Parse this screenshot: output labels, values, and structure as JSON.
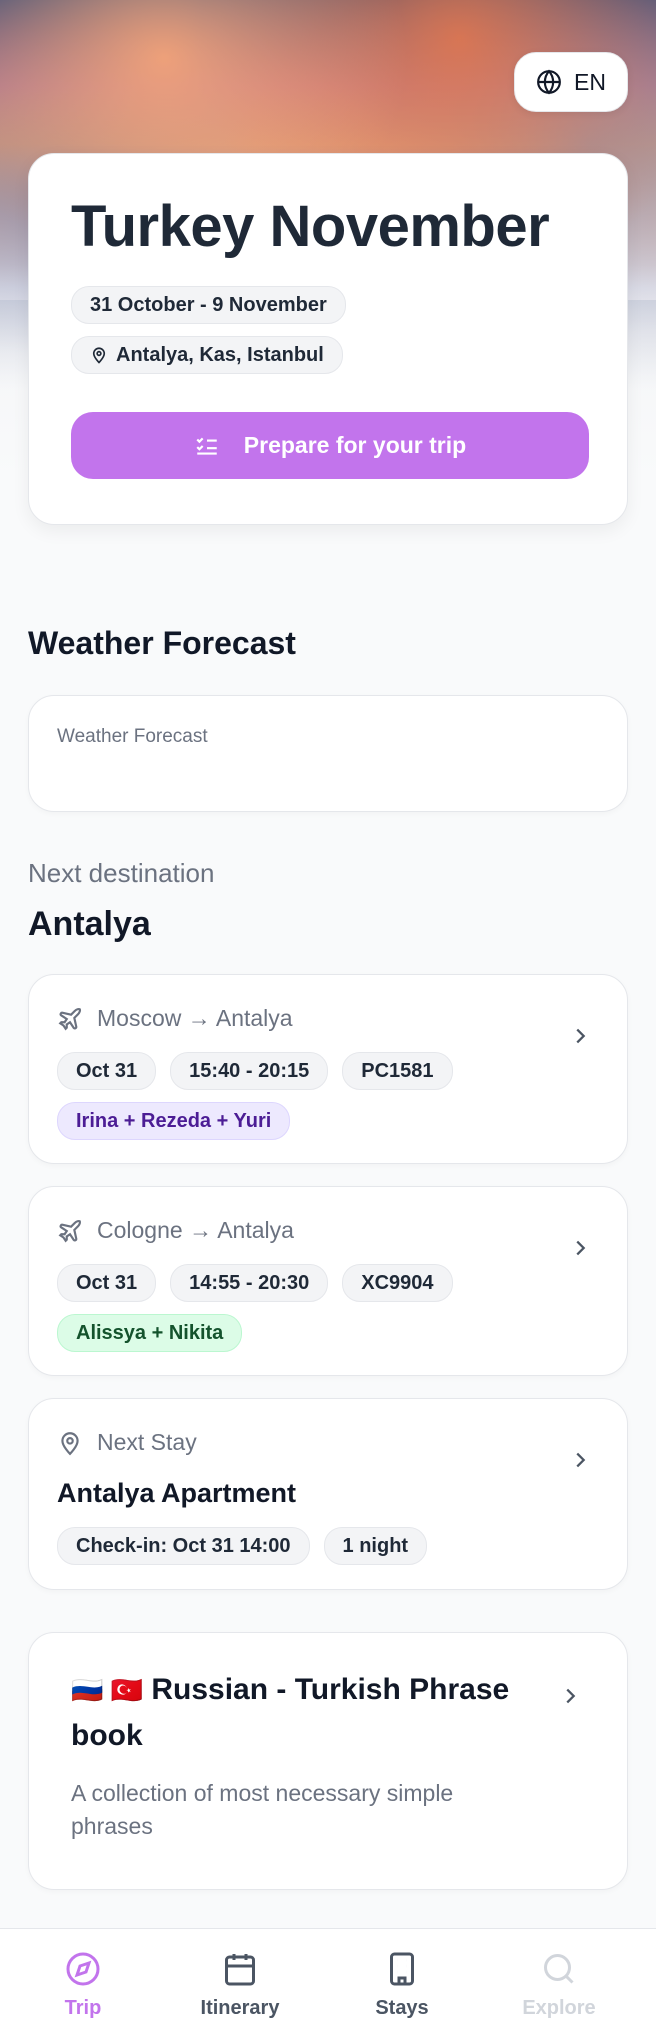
{
  "language": {
    "label": "EN",
    "icon": "globe-icon"
  },
  "trip": {
    "title": "Turkey November",
    "dates": "31 October - 9 November",
    "locations": "Antalya, Kas, Istanbul",
    "prepare_button": "Prepare for your trip"
  },
  "weather": {
    "section_title": "Weather Forecast",
    "placeholder": "Weather Forecast"
  },
  "next_destination": {
    "label": "Next destination",
    "city": "Antalya",
    "flights": [
      {
        "route": "Moscow → Antalya",
        "date": "Oct 31",
        "time": "15:40 - 20:15",
        "flight_no": "PC1581",
        "travelers": "Irina + Rezeda + Yuri",
        "traveler_color": "#ede9fe"
      },
      {
        "route": "Cologne → Antalya",
        "date": "Oct 31",
        "time": "14:55 - 20:30",
        "flight_no": "XC9904",
        "travelers": "Alissya + Nikita",
        "traveler_color": "#dcfce7"
      }
    ],
    "stay": {
      "label": "Next Stay",
      "name": "Antalya Apartment",
      "checkin": "Check-in: Oct 31 14:00",
      "nights": "1 night"
    }
  },
  "phrasebook": {
    "flags": "🇷🇺 🇹🇷",
    "title": "Russian - Turkish Phrase book",
    "description": "A collection of most necessary simple phrases"
  },
  "nav": {
    "items": [
      {
        "label": "Trip",
        "icon": "compass-icon",
        "active": true
      },
      {
        "label": "Itinerary",
        "icon": "calendar-icon",
        "active": false
      },
      {
        "label": "Stays",
        "icon": "building-icon",
        "active": false
      },
      {
        "label": "Explore",
        "icon": "search-icon",
        "active": false,
        "disabled": true
      }
    ]
  },
  "colors": {
    "accent": "#c274ec",
    "text": "#111827",
    "muted": "#6b7280"
  }
}
